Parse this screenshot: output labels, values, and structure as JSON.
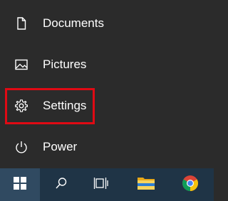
{
  "menu": {
    "items": [
      {
        "label": "Documents",
        "icon": "document-icon"
      },
      {
        "label": "Pictures",
        "icon": "pictures-icon"
      },
      {
        "label": "Settings",
        "icon": "gear-icon"
      },
      {
        "label": "Power",
        "icon": "power-icon"
      }
    ]
  },
  "highlight_color": "#e00a14",
  "taskbar": {
    "buttons": [
      "windows-start-icon",
      "search-icon",
      "task-view-icon",
      "file-explorer-icon",
      "chrome-icon"
    ]
  }
}
